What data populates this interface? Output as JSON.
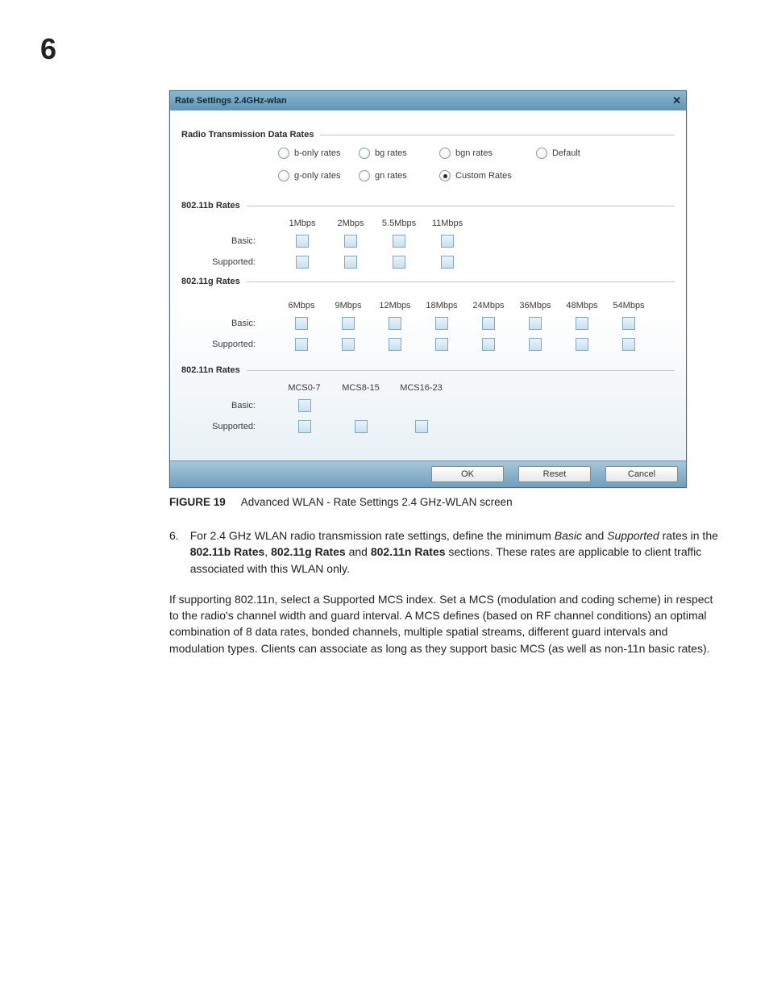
{
  "page": {
    "number": "6"
  },
  "dialog": {
    "title": "Rate Settings 2.4GHz-wlan",
    "close_glyph": "✕",
    "sections": {
      "transmission": {
        "heading": "Radio Transmission Data Rates",
        "options": {
          "b_only": "b-only rates",
          "bg": "bg rates",
          "bgn": "bgn rates",
          "default": "Default",
          "g_only": "g-only rates",
          "gn": "gn rates",
          "custom": "Custom Rates"
        },
        "selected": "custom"
      },
      "b_rates": {
        "heading": "802.11b Rates",
        "columns": [
          "1Mbps",
          "2Mbps",
          "5.5Mbps",
          "11Mbps"
        ],
        "rows": {
          "basic": "Basic:",
          "supported": "Supported:"
        }
      },
      "g_rates": {
        "heading": "802.11g Rates",
        "columns": [
          "6Mbps",
          "9Mbps",
          "12Mbps",
          "18Mbps",
          "24Mbps",
          "36Mbps",
          "48Mbps",
          "54Mbps"
        ],
        "rows": {
          "basic": "Basic:",
          "supported": "Supported:"
        }
      },
      "n_rates": {
        "heading": "802.11n Rates",
        "columns": [
          "MCS0-7",
          "MCS8-15",
          "MCS16-23"
        ],
        "rows": {
          "basic": "Basic:",
          "supported": "Supported:"
        }
      }
    },
    "buttons": {
      "ok": "OK",
      "reset": "Reset",
      "cancel": "Cancel"
    }
  },
  "caption": {
    "label": "FIGURE 19",
    "text": "Advanced WLAN - Rate Settings 2.4 GHz-WLAN screen"
  },
  "step": {
    "number": "6.",
    "pre": "For 2.4 GHz WLAN radio transmission rate settings, define the minimum ",
    "basic": "Basic",
    "mid1": " and ",
    "supported": "Supported",
    "mid2": " rates in the ",
    "b": "802.11b Rates",
    "c1": ", ",
    "g": "802.11g Rates",
    "c2": " and ",
    "n": "802.11n Rates",
    "post": " sections. These rates are applicable to client traffic associated with this WLAN only."
  },
  "paragraph": "If supporting 802.11n, select a Supported MCS index. Set a MCS (modulation and coding scheme) in respect to the radio's channel width and guard interval. A MCS defines (based on RF channel conditions) an optimal combination of 8 data rates, bonded channels, multiple spatial streams, different guard intervals and modulation types. Clients can associate as long as they support basic MCS (as well as non-11n basic rates)."
}
